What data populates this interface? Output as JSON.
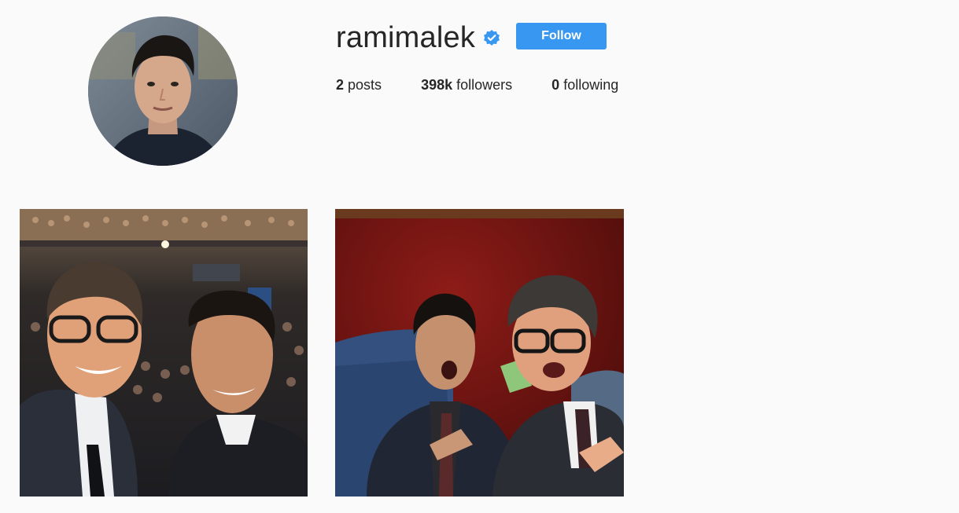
{
  "profile": {
    "username": "ramimalek",
    "verified_icon": "verified-badge-icon",
    "follow_label": "Follow",
    "accent_color": "#3897f0"
  },
  "stats": {
    "posts_count": "2",
    "posts_label": "posts",
    "followers_count": "398k",
    "followers_label": "followers",
    "following_count": "0",
    "following_label": "following"
  },
  "posts": [
    {
      "kind": "photo",
      "subject": "selfie in theater audience"
    },
    {
      "kind": "photo",
      "subject": "selfie on red stage set"
    }
  ]
}
